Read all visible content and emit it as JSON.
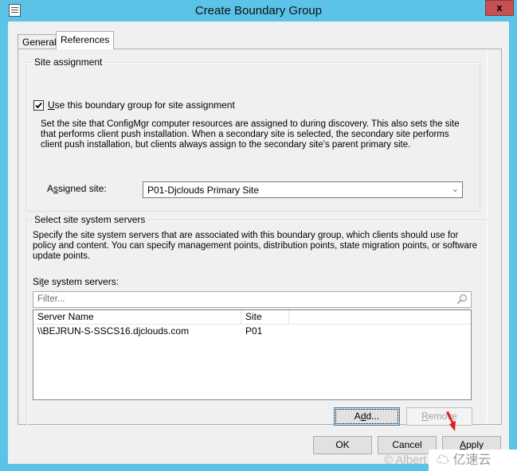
{
  "window": {
    "title": "Create Boundary Group",
    "close_label": "x"
  },
  "tabs": [
    {
      "label": "General",
      "active": false
    },
    {
      "label": "References",
      "active": true
    }
  ],
  "site_assignment": {
    "legend": "Site assignment",
    "checkbox_label_mnemonic": "U",
    "checkbox_label_rest": "se this boundary group for site assignment",
    "checked": true,
    "description": "Set the site that ConfigMgr computer resources are assigned to during discovery. This also sets the site that performs client push installation. When a secondary site is selected, the secondary site performs client push installation, but clients always assign to the secondary site's parent primary site.",
    "assigned_site_label_pre": "A",
    "assigned_site_label_mnemonic": "s",
    "assigned_site_label_rest": "signed site:",
    "assigned_site_value": "P01-Djclouds Primary Site"
  },
  "site_system_servers": {
    "legend": "Select site system servers",
    "description": "Specify the site system servers that are associated with this boundary group, which clients should use for policy and content. You can specify management points, distribution points, state migration points, or software update points.",
    "list_label_pre": "Si",
    "list_label_mnemonic": "t",
    "list_label_rest": "e system servers:",
    "filter_placeholder": "Filter...",
    "columns": [
      "Server Name",
      "Site"
    ],
    "rows": [
      {
        "server_name": "\\\\BEJRUN-S-SSCS16.djclouds.com",
        "site": "P01"
      }
    ],
    "add_label_pre": "A",
    "add_label_mnemonic": "d",
    "add_label_rest": "d...",
    "remove_label_mnemonic": "R",
    "remove_label_rest": "emove"
  },
  "footer": {
    "ok_label": "OK",
    "cancel_label": "Cancel",
    "apply_label_mnemonic": "A",
    "apply_label_rest": "pply"
  },
  "watermark": {
    "left_text": "© Albert",
    "right_text": "亿速云"
  },
  "colors": {
    "title_bar": "#5bc3e8",
    "close_button": "#c75050",
    "arrow": "#e02020"
  }
}
